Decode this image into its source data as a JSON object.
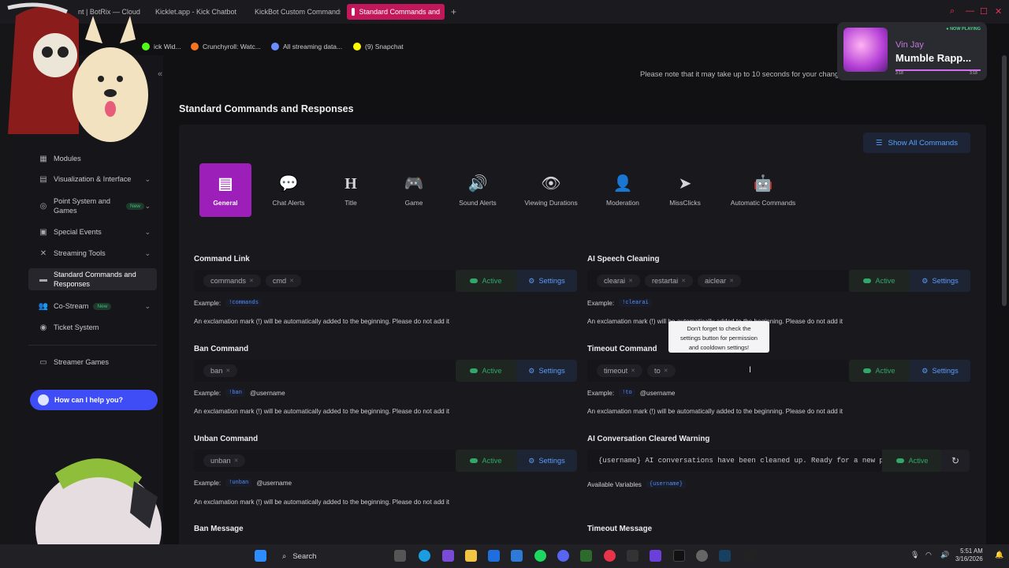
{
  "browser": {
    "tabs": [
      {
        "label": "nt | BotRix — Cloud",
        "color": "#cc2244"
      },
      {
        "label": "Kicklet.app - Kick Chatbot",
        "color": "#53fc18"
      },
      {
        "label": "KickBot Custom Commands",
        "color": "#53fc18"
      },
      {
        "label": "Standard Commands and",
        "color": "#ffffff"
      }
    ],
    "new_tab": "+",
    "bookmarks": [
      {
        "label": "ick Wid...",
        "color": "#53fc18"
      },
      {
        "label": "Crunchyroll: Watc...",
        "color": "#f47521"
      },
      {
        "label": "All streaming data...",
        "color": "#6a8cff"
      },
      {
        "label": "(9) Snapchat",
        "color": "#fffc00"
      }
    ],
    "window_controls": [
      "⌕",
      "—",
      "☐",
      "✕"
    ]
  },
  "sidebar": {
    "items": [
      {
        "label": "Modules",
        "icon": "grid-icon"
      },
      {
        "label": "Visualization & Interface",
        "icon": "layers-icon",
        "chevron": "⌄"
      },
      {
        "label": "Point System and Games",
        "icon": "coins-icon",
        "badge": "New",
        "chevron": "⌄"
      },
      {
        "label": "Special Events",
        "icon": "calendar-icon",
        "chevron": "⌄"
      },
      {
        "label": "Streaming Tools",
        "icon": "tools-icon",
        "chevron": "⌄"
      },
      {
        "label": "Standard Commands and Responses",
        "icon": "list-icon"
      },
      {
        "label": "Co-Stream",
        "icon": "users-icon",
        "badge": "New",
        "chevron": "⌄"
      },
      {
        "label": "Ticket System",
        "icon": "ticket-icon"
      },
      {
        "label": "Streamer Games",
        "icon": "gamepad-icon"
      }
    ],
    "help_button": "How can I help you?"
  },
  "header": {
    "notice": "Please note that it may take up to 10 seconds for your change",
    "page_title": "Standard Commands and Responses",
    "show_all": "Show All Commands"
  },
  "categories": [
    {
      "label": "General",
      "glyph": "▤",
      "icon": "general-icon",
      "selected": true
    },
    {
      "label": "Chat Alerts",
      "glyph": "💬",
      "icon": "chat-icon"
    },
    {
      "label": "Title",
      "glyph": "H",
      "icon": "heading-icon"
    },
    {
      "label": "Game",
      "glyph": "🎮",
      "icon": "gamepad-icon"
    },
    {
      "label": "Sound Alerts",
      "glyph": "🔊",
      "icon": "ear-icon"
    },
    {
      "label": "Viewing Durations",
      "glyph": "👁",
      "icon": "eye-icon"
    },
    {
      "label": "Moderation",
      "glyph": "👤",
      "icon": "user-shield-icon"
    },
    {
      "label": "MissClicks",
      "glyph": "➤",
      "icon": "cursor-icon"
    },
    {
      "label": "Automatic Commands",
      "glyph": "🤖",
      "icon": "robot-icon"
    }
  ],
  "commands": {
    "active_label": "Active",
    "settings_label": "Settings",
    "example_label": "Example:",
    "hint": "An exclamation mark (!) will be automatically added to the beginning. Please do not add it",
    "command_link": {
      "title": "Command Link",
      "chips": [
        "commands",
        "cmd"
      ],
      "example_code": "!commands",
      "example_suffix": ""
    },
    "ai_speech": {
      "title": "AI Speech Cleaning",
      "chips": [
        "clearai",
        "restartai",
        "aiclear"
      ],
      "example_code": "!clearai",
      "example_suffix": ""
    },
    "ban": {
      "title": "Ban Command",
      "chips": [
        "ban"
      ],
      "example_code": "!ban",
      "example_suffix": "@username"
    },
    "timeout": {
      "title": "Timeout Command",
      "chips": [
        "timeout",
        "to"
      ],
      "example_code": "!to",
      "example_suffix": "@username"
    },
    "unban": {
      "title": "Unban Command",
      "chips": [
        "unban"
      ],
      "example_code": "!unban",
      "example_suffix": "@username"
    },
    "ai_conv": {
      "title": "AI Conversation Cleared Warning",
      "message": "{username} AI conversations have been cleaned up. Ready for a new per",
      "vars_label": "Available Variables",
      "var": "{username}"
    },
    "ban_msg": {
      "title": "Ban Message"
    },
    "timeout_msg": {
      "title": "Timeout Message"
    }
  },
  "tooltip": {
    "line1": "Don't forget to check the",
    "line2": "settings button for permission",
    "line3": "and cooldown settings!"
  },
  "now_playing": {
    "badge": "● NOW PLAYING",
    "artist": "Vin Jay",
    "title": "Mumble Rapp...",
    "elapsed": "3:18",
    "total": "3:18",
    "progress": 1.0
  },
  "taskbar": {
    "search": "Search",
    "time": "5:51 AM",
    "date": "3/16/2026"
  }
}
